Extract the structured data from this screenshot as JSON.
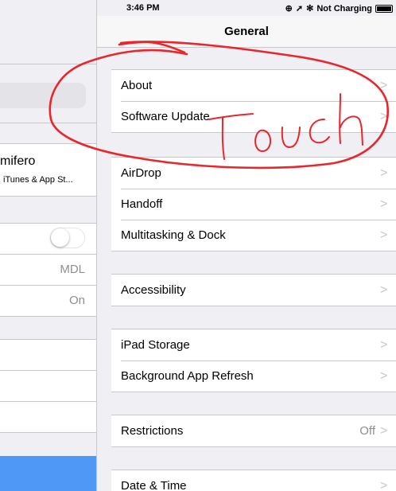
{
  "status_bar": {
    "time": "3:46 PM",
    "charging_text": "Not Charging",
    "icons": [
      "location-lock-icon",
      "location-arrow-icon",
      "bluetooth-icon",
      "battery-icon"
    ]
  },
  "left_panel": {
    "account": {
      "name": "mifero",
      "subtitle": "iTunes & App St..."
    },
    "row_values": {
      "language_value": "MDL",
      "bluetooth_value": "On"
    }
  },
  "detail": {
    "title": "General",
    "groups": [
      {
        "rows": [
          {
            "label": "About"
          },
          {
            "label": "Software Update"
          }
        ]
      },
      {
        "rows": [
          {
            "label": "AirDrop"
          },
          {
            "label": "Handoff"
          },
          {
            "label": "Multitasking & Dock"
          }
        ]
      },
      {
        "rows": [
          {
            "label": "Accessibility"
          }
        ]
      },
      {
        "rows": [
          {
            "label": "iPad Storage"
          },
          {
            "label": "Background App Refresh"
          }
        ]
      },
      {
        "rows": [
          {
            "label": "Restrictions",
            "value": "Off"
          }
        ]
      },
      {
        "rows": [
          {
            "label": "Date & Time"
          }
        ]
      }
    ]
  },
  "annotation": {
    "text": "touch",
    "color": "#e8262b"
  },
  "colors": {
    "accent_blue": "#4f98f5",
    "background": "#efeff4",
    "separator": "#c8c7cc"
  }
}
